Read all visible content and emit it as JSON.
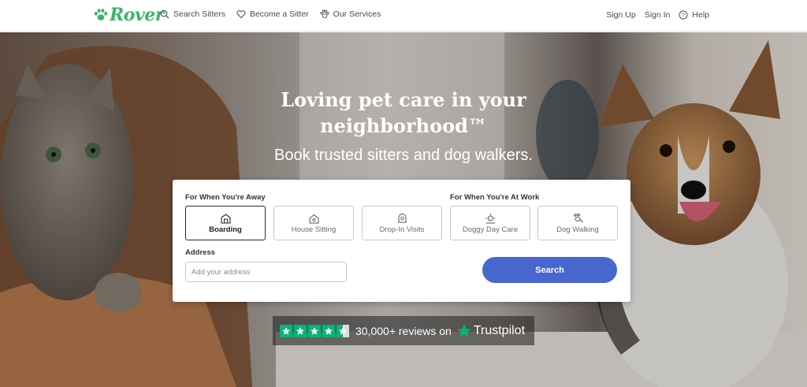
{
  "brand": {
    "name": "Rover",
    "color": "#3ab66b",
    "icon": "paw-icon"
  },
  "nav": {
    "left": [
      {
        "label": "Search Sitters",
        "icon": "search-icon"
      },
      {
        "label": "Become a Sitter",
        "icon": "heart-icon"
      },
      {
        "label": "Our Services",
        "icon": "paw-outline-icon"
      }
    ],
    "sign_up": "Sign Up",
    "sign_in": "Sign In",
    "help": "Help"
  },
  "hero": {
    "title_line1": "Loving pet care in your",
    "title_line2": "neighborhood™",
    "subtitle": "Book trusted sitters and dog walkers."
  },
  "search": {
    "away_label": "For When You're Away",
    "work_label": "For When You're At Work",
    "services": [
      {
        "label": "Boarding",
        "icon": "boarding-icon",
        "selected": true
      },
      {
        "label": "House Sitting",
        "icon": "house-sitting-icon",
        "selected": false
      },
      {
        "label": "Drop-In Visits",
        "icon": "drop-in-icon",
        "selected": false
      },
      {
        "label": "Doggy Day Care",
        "icon": "day-care-icon",
        "selected": false
      },
      {
        "label": "Dog Walking",
        "icon": "dog-walking-icon",
        "selected": false
      }
    ],
    "address_label": "Address",
    "address_placeholder": "Add your address",
    "address_value": "",
    "button_label": "Search",
    "button_color": "#4767cf"
  },
  "trustpilot": {
    "rating_stars": 4.5,
    "text": "30,000+ reviews on",
    "brand": "Trustpilot",
    "star_color": "#00b67a"
  }
}
